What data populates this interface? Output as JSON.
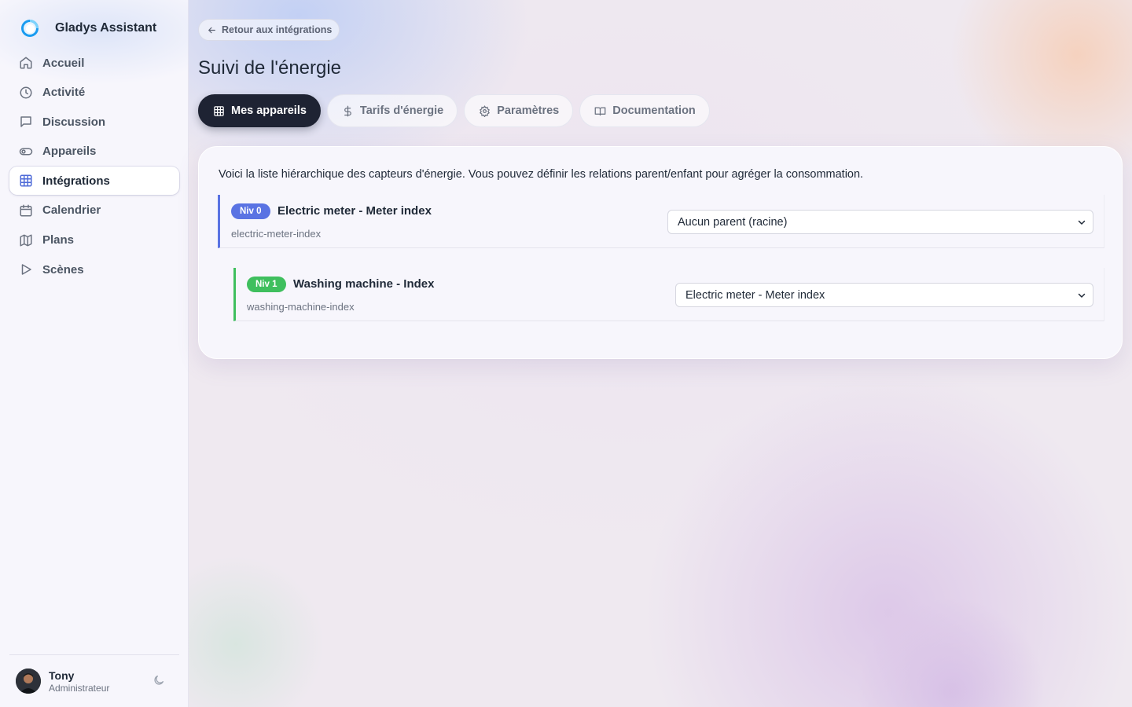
{
  "app": {
    "name": "Gladys Assistant"
  },
  "sidebar": {
    "items": [
      {
        "label": "Accueil",
        "icon": "home-icon"
      },
      {
        "label": "Activité",
        "icon": "clock-icon"
      },
      {
        "label": "Discussion",
        "icon": "chat-icon"
      },
      {
        "label": "Appareils",
        "icon": "toggle-icon"
      },
      {
        "label": "Intégrations",
        "icon": "grid-icon",
        "active": true
      },
      {
        "label": "Calendrier",
        "icon": "calendar-icon"
      },
      {
        "label": "Plans",
        "icon": "map-icon"
      },
      {
        "label": "Scènes",
        "icon": "play-icon"
      }
    ],
    "user": {
      "name": "Tony",
      "role": "Administrateur"
    }
  },
  "header": {
    "back_label": "Retour aux intégrations",
    "title": "Suivi de l'énergie"
  },
  "tabs": [
    {
      "label": "Mes appareils",
      "icon": "grid-icon",
      "active": true
    },
    {
      "label": "Tarifs d'énergie",
      "icon": "dollar-icon"
    },
    {
      "label": "Paramètres",
      "icon": "gear-icon"
    },
    {
      "label": "Documentation",
      "icon": "book-icon"
    }
  ],
  "main": {
    "intro": "Voici la liste hiérarchique des capteurs d'énergie. Vous pouvez définir les relations parent/enfant pour agréger la consommation.",
    "sensors": [
      {
        "level": "Niv 0",
        "name": "Electric meter - Meter index",
        "key": "electric-meter-index",
        "parent": "Aucun parent (racine)"
      },
      {
        "level": "Niv 1",
        "name": "Washing machine - Index",
        "key": "washing-machine-index",
        "parent": "Electric meter - Meter index"
      }
    ]
  },
  "colors": {
    "accent": "#4f6bd8",
    "level0": "#5a73e3",
    "level1": "#3fbf5e",
    "tab_active": "#1e2333"
  }
}
